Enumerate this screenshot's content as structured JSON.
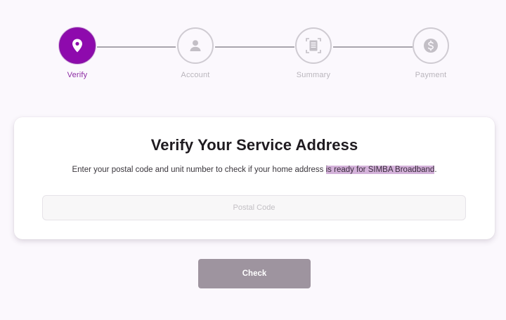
{
  "stepper": {
    "steps": [
      {
        "label": "Verify",
        "icon": "location-pin-icon",
        "active": true
      },
      {
        "label": "Account",
        "icon": "user-icon",
        "active": false
      },
      {
        "label": "Summary",
        "icon": "document-icon",
        "active": false
      },
      {
        "label": "Payment",
        "icon": "dollar-icon",
        "active": false
      }
    ]
  },
  "card": {
    "title": "Verify Your Service Address",
    "description_part1": "Enter your postal code and unit number to check if your home address ",
    "description_highlight": "is ready for SIMBA Broadband",
    "description_part2": ".",
    "postal_input": {
      "value": "",
      "placeholder": "Postal Code"
    }
  },
  "actions": {
    "check_label": "Check"
  },
  "colors": {
    "accent": "#8e0aad",
    "inactive_step": "#cfcbd2",
    "button_disabled": "#9e949f",
    "highlight": "#d4b2da",
    "background": "#fbf8fd"
  }
}
